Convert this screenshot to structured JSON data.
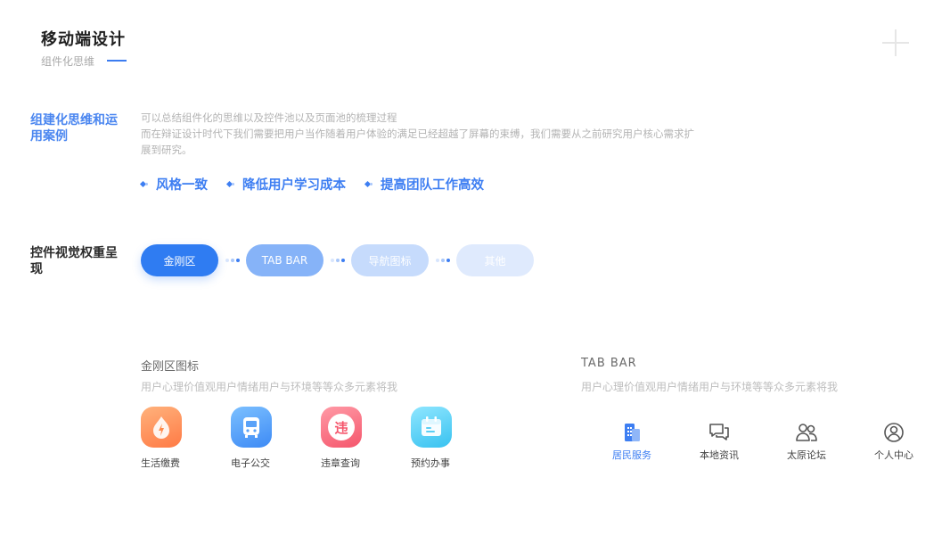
{
  "header": {
    "title": "移动端设计",
    "subtitle": "组件化思维"
  },
  "section1": {
    "title": "组建化思维和运用案例",
    "desc_lines": [
      "可以总结组件化的思维以及控件池以及页面池的梳理过程",
      "而在辩证设计时代下我们需要把用户当作随着用户体验的满足已经超越了屏幕的束缚，我们需要从之前研究用户核心需求扩",
      "展到研究。"
    ],
    "bullets": [
      "风格一致",
      "降低用户学习成本",
      "提高团队工作高效"
    ]
  },
  "section2": {
    "title": "控件视觉权重呈现",
    "pills": [
      "金刚区",
      "TAB BAR",
      "导航图标",
      "其他"
    ]
  },
  "icon_group": {
    "title": "金刚区图标",
    "desc": "用户心理价值观用户情绪用户与环境等等众多元素将我",
    "items": [
      {
        "label": "生活缴费",
        "icon": "flame-icon"
      },
      {
        "label": "电子公交",
        "icon": "bus-icon"
      },
      {
        "label": "违章查询",
        "icon": "violation-icon",
        "glyph": "违"
      },
      {
        "label": "预约办事",
        "icon": "calendar-icon"
      }
    ]
  },
  "tabbar_group": {
    "title": "TAB BAR",
    "desc": "用户心理价值观用户情绪用户与环境等等众多元素将我",
    "tabs": [
      {
        "label": "居民服务",
        "icon": "building-icon",
        "active": true
      },
      {
        "label": "本地资讯",
        "icon": "chat-icon",
        "active": false
      },
      {
        "label": "太原论坛",
        "icon": "users-icon",
        "active": false
      },
      {
        "label": "个人中心",
        "icon": "user-circle-icon",
        "active": false
      }
    ]
  },
  "colors": {
    "accent": "#3d7ef2",
    "pill_active": "#2f7cf2"
  }
}
